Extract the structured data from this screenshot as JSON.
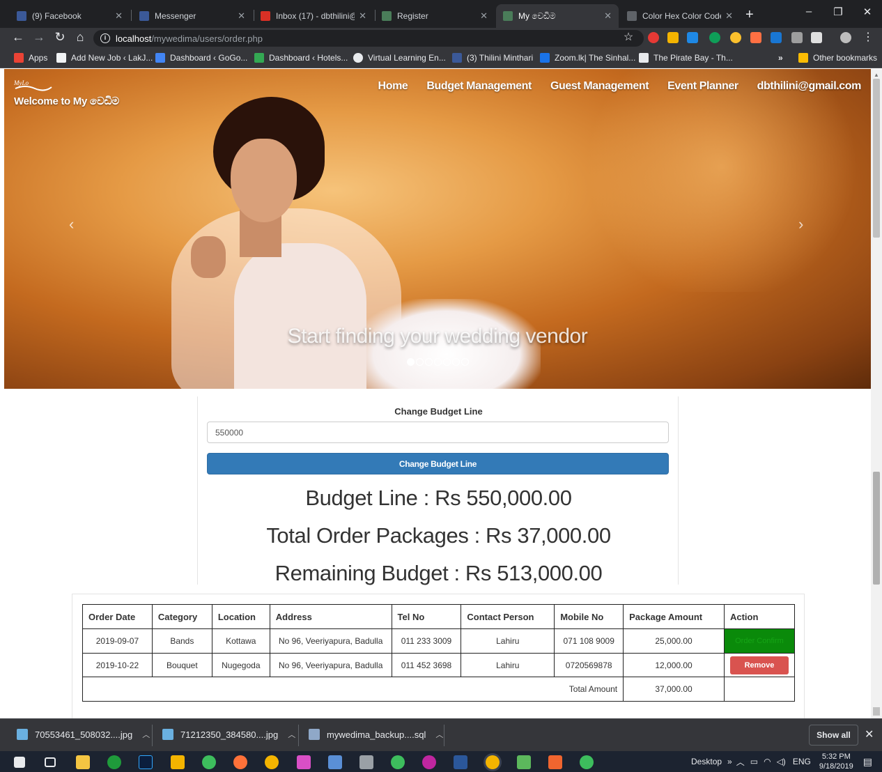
{
  "browser": {
    "tabs": [
      {
        "label": "(9) Facebook",
        "color": "#3b5998"
      },
      {
        "label": "Messenger",
        "color": "#3b5998"
      },
      {
        "label": "Inbox (17) - dbthilini@",
        "color": "#d93025"
      },
      {
        "label": "Register",
        "color": "#4a7c59"
      },
      {
        "label": "My වෙඩිම",
        "color": "#4a7c59"
      },
      {
        "label": "Color Hex Color Codes",
        "color": "#5f6368"
      }
    ],
    "url_host": "localhost",
    "url_path": "/mywedima/users/order.php",
    "bookmarks": [
      {
        "label": "Apps",
        "color": "#ea4335"
      },
      {
        "label": "Add New Job ‹ LakJ...",
        "color": "#f1f3f4"
      },
      {
        "label": "Dashboard ‹ GoGo...",
        "color": "#4285f4"
      },
      {
        "label": "Dashboard ‹ Hotels...",
        "color": "#34a853"
      },
      {
        "label": "Virtual Learning En...",
        "color": "#e8eaed"
      },
      {
        "label": "(3) Thilini Minthari",
        "color": "#3b5998"
      },
      {
        "label": "Zoom.lk| The Sinhal...",
        "color": "#1a73e8"
      },
      {
        "label": "The Pirate Bay - Th...",
        "color": "#e8eaed"
      },
      {
        "label": "»",
        "color": ""
      },
      {
        "label": "Other bookmarks",
        "color": "#fbbc04"
      }
    ]
  },
  "site": {
    "welcome": "Welcome to My වෙඩිම",
    "nav": [
      "Home",
      "Budget Management",
      "Guest Management",
      "Event Planner",
      "dbthilini@gmail.com"
    ],
    "carousel_caption": "Start finding your wedding vendor",
    "carousel_slide_count": 7,
    "carousel_active_slide": 1
  },
  "budget": {
    "label": "Change Budget Line",
    "input_value": "550000",
    "button_label": "Change Budget Line",
    "budget_line": "Budget Line : Rs 550,000.00",
    "total_orders": "Total Order Packages : Rs 37,000.00",
    "remaining": "Remaining Budget : Rs 513,000.00"
  },
  "orders": {
    "headers": [
      "Order Date",
      "Category",
      "Location",
      "Address",
      "Tel No",
      "Contact Person",
      "Mobile No",
      "Package Amount",
      "Action"
    ],
    "rows": [
      {
        "date": "2019-09-07",
        "category": "Bands",
        "location": "Kottawa",
        "address": "No 96, Veeriyapura, Badulla",
        "tel": "011 233 3009",
        "contact": "Lahiru",
        "mobile": "071 108 9009",
        "amount": "25,000.00",
        "action": "Order Confirm"
      },
      {
        "date": "2019-10-22",
        "category": "Bouquet",
        "location": "Nugegoda",
        "address": "No 96, Veeriyapura, Badulla",
        "tel": "011 452 3698",
        "contact": "Lahiru",
        "mobile": "0720569878",
        "amount": "12,000.00",
        "action": "Remove"
      }
    ],
    "total_label": "Total Amount",
    "total_value": "37,000.00"
  },
  "downloads": {
    "items": [
      "70553461_508032....jpg",
      "71212350_384580....jpg",
      "mywedima_backup....sql"
    ],
    "show_all": "Show all"
  },
  "taskbar": {
    "desktop_label": "Desktop",
    "lang": "ENG",
    "time": "5:32 PM",
    "date": "9/18/2019"
  }
}
